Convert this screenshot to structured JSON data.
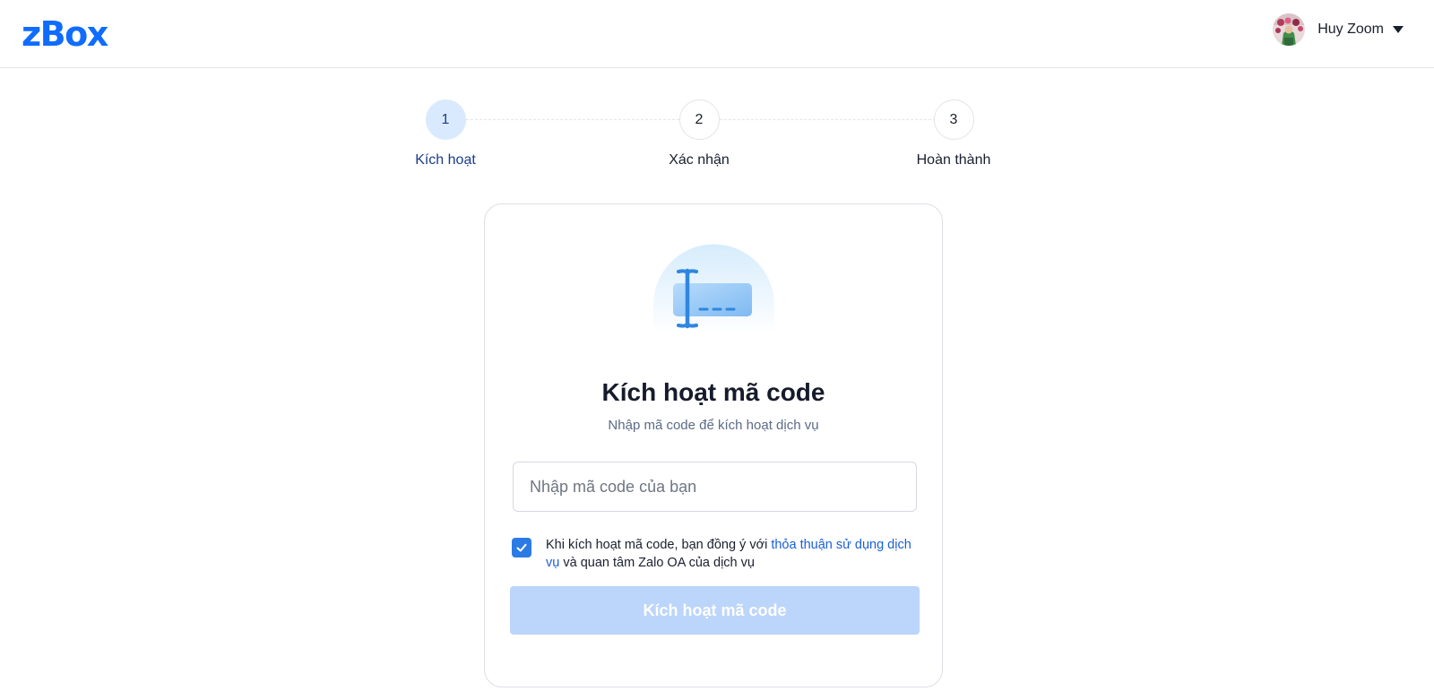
{
  "header": {
    "logo": "zBox",
    "user": {
      "name": "Huy Zoom"
    }
  },
  "stepper": {
    "steps": [
      {
        "number": "1",
        "label": "Kích hoạt",
        "active": true
      },
      {
        "number": "2",
        "label": "Xác nhận",
        "active": false
      },
      {
        "number": "3",
        "label": "Hoàn thành",
        "active": false
      }
    ]
  },
  "card": {
    "illustration_icon": "code-input-illustration",
    "title": "Kích hoạt mã code",
    "subtitle": "Nhập mã code để kích hoạt dịch vụ",
    "input": {
      "placeholder": "Nhập mã code của bạn",
      "value": ""
    },
    "agreement": {
      "checked": true,
      "text_before": "Khi kích hoạt mã code, bạn đồng ý với ",
      "link_text": "thỏa thuận sử dụng dịch vụ",
      "text_after": " và quan tâm Zalo OA của dịch vụ"
    },
    "submit_label": "Kích hoạt mã code"
  },
  "colors": {
    "brand": "#0f6cff",
    "active_step_bg": "#d9eaff",
    "link": "#1a5fd6",
    "checkbox": "#2c7be5",
    "submit_disabled": "#bcd5fb"
  }
}
